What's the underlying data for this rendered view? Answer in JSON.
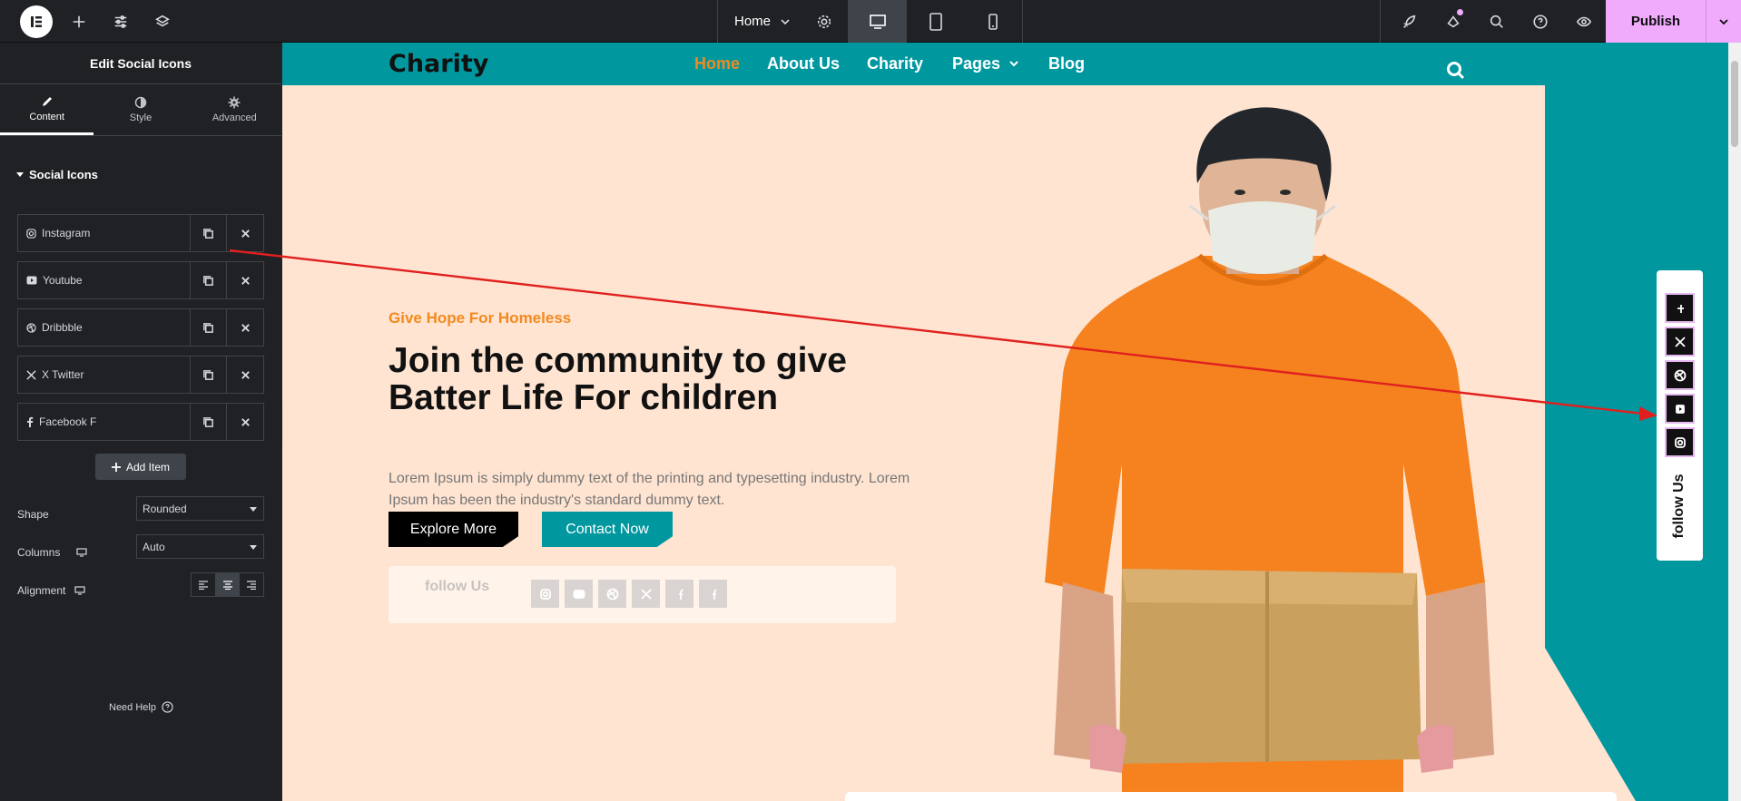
{
  "topbar": {
    "page_name": "Home",
    "publish_label": "Publish",
    "icons": [
      "elementor-logo",
      "plus-icon",
      "sliders-icon",
      "layers-icon",
      "settings-icon",
      "desktop-icon",
      "tablet-icon",
      "mobile-icon",
      "rocket-icon",
      "notification-icon",
      "search-icon",
      "help-icon",
      "eye-icon",
      "chevron-down-icon"
    ],
    "accent": "#f0abfc"
  },
  "panel": {
    "title": "Edit Social Icons",
    "tabs": [
      {
        "label": "Content",
        "icon": "pencil-icon",
        "active": true
      },
      {
        "label": "Style",
        "icon": "contrast-icon",
        "active": false
      },
      {
        "label": "Advanced",
        "icon": "gear-icon",
        "active": false
      }
    ],
    "section_title": "Social Icons",
    "items": [
      {
        "label": "Instagram",
        "icon": "instagram-icon"
      },
      {
        "label": "Youtube",
        "icon": "youtube-icon"
      },
      {
        "label": "Dribbble",
        "icon": "dribbble-icon"
      },
      {
        "label": "X Twitter",
        "icon": "x-twitter-icon"
      },
      {
        "label": "Facebook F",
        "icon": "facebook-icon"
      }
    ],
    "add_item_label": "Add Item",
    "shape_label": "Shape",
    "shape_value": "Rounded",
    "columns_label": "Columns",
    "columns_value": "Auto",
    "alignment_label": "Alignment",
    "need_help_label": "Need Help"
  },
  "site": {
    "brand": "Charity",
    "nav": [
      "Home",
      "About Us",
      "Charity",
      "Pages",
      "Blog"
    ],
    "nav_active": "Home",
    "kicker": "Give Hope For Homeless",
    "headline": "Join the community to give Batter Life For children",
    "body": "Lorem Ipsum is simply dummy text of the printing and typesetting industry. Lorem Ipsum has been the industry's standard dummy text.",
    "explore_label": "Explore More",
    "contact_label": "Contact Now",
    "follow_label": "follow Us",
    "float_label": "follow Us",
    "colors": {
      "teal": "#00979f",
      "orange": "#f28a1e",
      "hero_bg": "#ffe4d1"
    }
  }
}
